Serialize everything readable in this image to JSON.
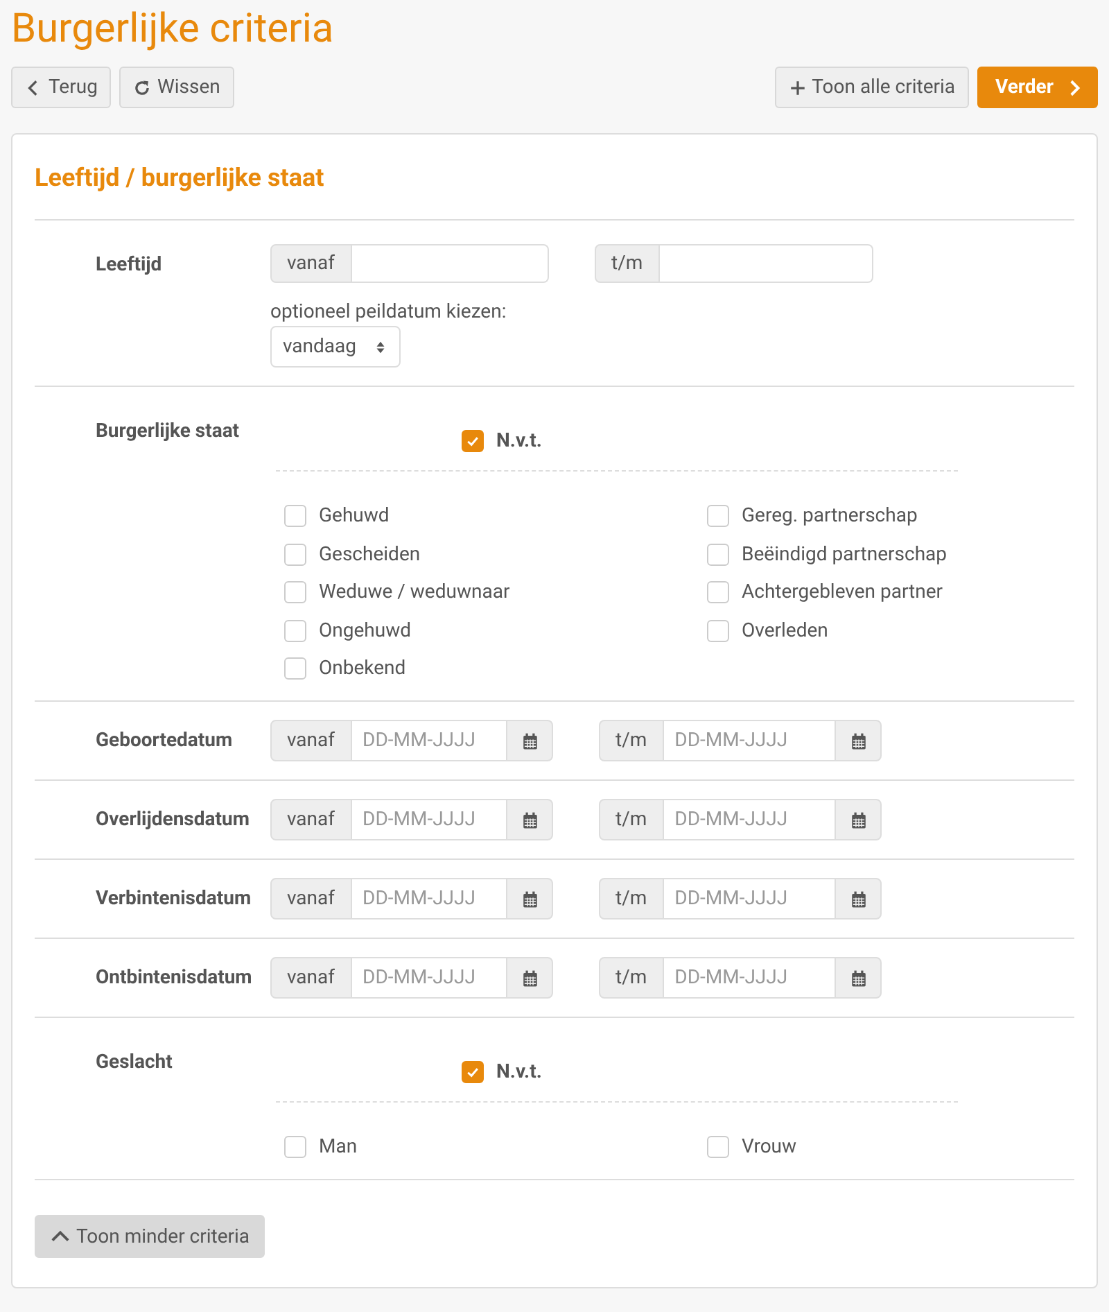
{
  "title": "Burgerlijke criteria",
  "toolbar": {
    "left": [
      {
        "kind": "back",
        "label": "Terug"
      },
      {
        "kind": "reset",
        "label": "Wissen"
      }
    ],
    "right": [
      {
        "kind": "expand",
        "label": "Toon alle criteria"
      },
      {
        "kind": "next",
        "label": "Verder"
      }
    ]
  },
  "card": {
    "title": "Leeftijd / burgerlijke staat",
    "sections": [
      {
        "kind": "range",
        "label": "Leeftijd",
        "from": {
          "addon": "vanaf"
        },
        "to": {
          "addon": "t/m"
        },
        "reference": {
          "caption": "optioneel peildatum kiezen:",
          "value": "vandaag"
        }
      },
      {
        "kind": "choices",
        "label": "Burgerlijke staat",
        "na": {
          "label": "N.v.t.",
          "checked": true
        },
        "columns": [
          [
            {
              "label": "Gehuwd",
              "checked": false
            },
            {
              "label": "Gescheiden",
              "checked": false
            },
            {
              "label": "Weduwe / weduwnaar",
              "checked": false
            },
            {
              "label": "Ongehuwd",
              "checked": false
            },
            {
              "label": "Onbekend",
              "checked": false
            }
          ],
          [
            {
              "label": "Gereg. partnerschap",
              "checked": false
            },
            {
              "label": "Beëindigd partnerschap",
              "checked": false
            },
            {
              "label": "Achtergebleven partner",
              "checked": false
            },
            {
              "label": "Overleden",
              "checked": false
            }
          ]
        ]
      },
      {
        "kind": "date-range",
        "label": "Geboortedatum",
        "from": {
          "addon": "vanaf",
          "placeholder": "DD-MM-JJJJ"
        },
        "to": {
          "addon": "t/m",
          "placeholder": "DD-MM-JJJJ"
        }
      },
      {
        "kind": "date-range",
        "label": "Overlijdensdatum",
        "from": {
          "addon": "vanaf",
          "placeholder": "DD-MM-JJJJ"
        },
        "to": {
          "addon": "t/m",
          "placeholder": "DD-MM-JJJJ"
        }
      },
      {
        "kind": "date-range",
        "label": "Verbintenisdatum",
        "from": {
          "addon": "vanaf",
          "placeholder": "DD-MM-JJJJ"
        },
        "to": {
          "addon": "t/m",
          "placeholder": "DD-MM-JJJJ"
        }
      },
      {
        "kind": "date-range",
        "label": "Ontbintenisdatum",
        "from": {
          "addon": "vanaf",
          "placeholder": "DD-MM-JJJJ"
        },
        "to": {
          "addon": "t/m",
          "placeholder": "DD-MM-JJJJ"
        }
      },
      {
        "kind": "choices",
        "label": "Geslacht",
        "na": {
          "label": "N.v.t.",
          "checked": true
        },
        "columns": [
          [
            {
              "label": "Man",
              "checked": false
            }
          ],
          [
            {
              "label": "Vrouw",
              "checked": false
            }
          ]
        ]
      }
    ],
    "footer_button": {
      "kind": "collapse",
      "label": "Toon minder criteria"
    }
  }
}
